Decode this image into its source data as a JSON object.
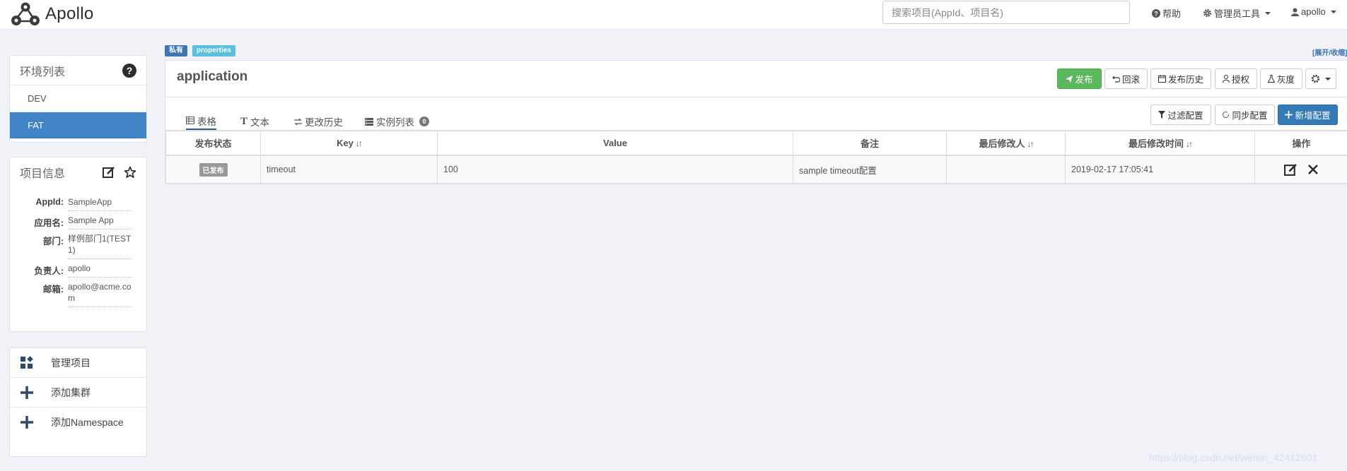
{
  "navbar": {
    "brand": "Apollo",
    "search_placeholder": "搜索项目(AppId、项目名)",
    "help": "帮助",
    "admin_tools": "管理员工具",
    "user": "apollo"
  },
  "env_panel": {
    "title": "环境列表",
    "items": [
      {
        "label": "DEV",
        "active": false
      },
      {
        "label": "FAT",
        "active": true
      }
    ]
  },
  "project_info": {
    "title": "项目信息",
    "rows": [
      {
        "label": "AppId:",
        "value": "SampleApp"
      },
      {
        "label": "应用名:",
        "value": "Sample App"
      },
      {
        "label": "部门:",
        "value": "样例部门1(TEST1)"
      },
      {
        "label": "负责人:",
        "value": "apollo"
      },
      {
        "label": "邮箱:",
        "value": "apollo@acme.com"
      }
    ]
  },
  "actions": [
    {
      "label": "管理项目",
      "icon": "dashboard-icon"
    },
    {
      "label": "添加集群",
      "icon": "plus-icon"
    },
    {
      "label": "添加Namespace",
      "icon": "plus-icon"
    }
  ],
  "namespace": {
    "tag_private": "私有",
    "tag_format": "properties",
    "toggle": "[展开/收缩]",
    "title": "application",
    "buttons": {
      "publish": "发布",
      "rollback": "回滚",
      "history": "发布历史",
      "authorize": "授权",
      "gray": "灰度"
    },
    "tabs": [
      {
        "label": "表格",
        "icon": "table-icon",
        "active": true
      },
      {
        "label": "文本",
        "icon": "text-icon",
        "active": false
      },
      {
        "label": "更改历史",
        "icon": "history-icon",
        "active": false
      },
      {
        "label": "实例列表",
        "icon": "instances-icon",
        "active": false,
        "badge": "0"
      }
    ],
    "tool_buttons": {
      "filter": "过滤配置",
      "sync": "同步配置",
      "add": "新增配置"
    },
    "table": {
      "headers": [
        "发布状态",
        "Key",
        "Value",
        "备注",
        "最后修改人",
        "最后修改时间",
        "操作"
      ],
      "rows": [
        {
          "status": "已发布",
          "key": "timeout",
          "value": "100",
          "comment": "sample timeout配置",
          "modifier": "",
          "time": "2019-02-17 17:05:41"
        }
      ]
    }
  },
  "watermark": "https://blog.csdn.net/weixin_42412601",
  "colors": {
    "primary": "#4084c7",
    "success": "#5cb85c",
    "blue_button": "#337ab7",
    "tag_private": "#3e75b3",
    "tag_format": "#5bc0de"
  }
}
